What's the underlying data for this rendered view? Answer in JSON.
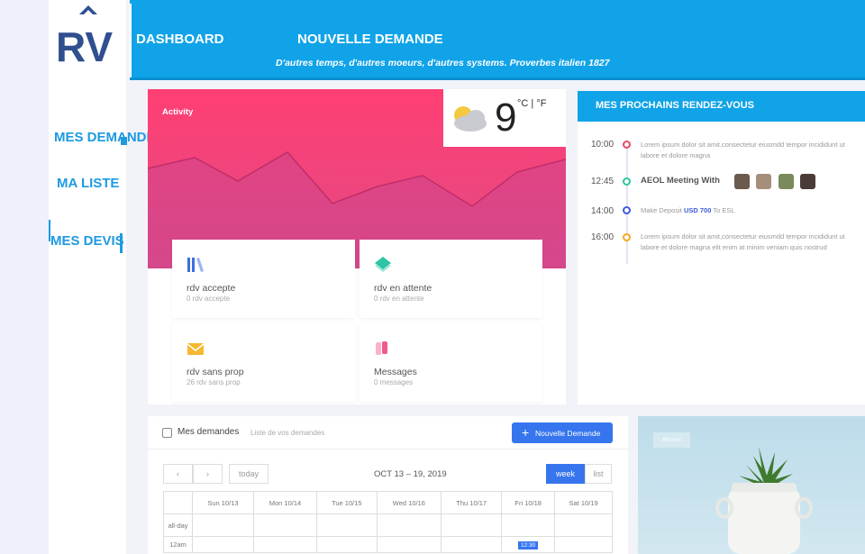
{
  "brand": {
    "logo_text": "RV"
  },
  "sidebar": {
    "items": [
      {
        "label": "MES DEMANDES"
      },
      {
        "label": "MA LISTE"
      },
      {
        "label": "MES DEVIS"
      }
    ]
  },
  "header": {
    "links": [
      {
        "label": "DASHBOARD"
      },
      {
        "label": "NOUVELLE DEMANDE"
      }
    ],
    "proverb": "D'autres temps, d'autres moeurs, d'autres systems. Proverbes italien 1827"
  },
  "activity": {
    "title": "Activity",
    "weather": {
      "temperature": "9",
      "units": "°C | °F",
      "icon": "partly-cloudy-icon"
    },
    "stats": [
      {
        "title": "rdv accepte",
        "subtitle": "0 rdv accepte",
        "icon": "books-icon",
        "color": "#3b6fe0"
      },
      {
        "title": "rdv en attente",
        "subtitle": "0 rdv en attente",
        "icon": "layers-icon",
        "color": "#2ec4a6"
      },
      {
        "title": "rdv sans prop",
        "subtitle": "26 rdv sans prop",
        "icon": "envelope-icon",
        "color": "#f5b82e"
      },
      {
        "title": "Messages",
        "subtitle": "0 messages",
        "icon": "message-icon",
        "color": "#f05c8c"
      }
    ]
  },
  "rendezvous": {
    "title": "MES PROCHAINS RENDEZ-VOUS",
    "events": [
      {
        "time": "10:00",
        "text": "Lorem ipsum dolor sit amit,consectetur eiusmdd tempor incididunt ut labore et dolore magna",
        "color": "#e84a6d"
      },
      {
        "time": "12:45",
        "text": "AEOL Meeting With",
        "color": "#2ec4a6"
      },
      {
        "time": "14:00",
        "text_before": "Make Deposit",
        "amount": "USD 700",
        "text_after": "To ESL",
        "color": "#3b5bdb"
      },
      {
        "time": "16:00",
        "text": "Lorem ipsum dolor sit amit,consectetur eiusmdd tempor incididunt ut labore et dolore magna elit enim at minim veniam quis nostrud",
        "color": "#f5a623"
      }
    ]
  },
  "demandes": {
    "title": "Mes demandes",
    "subtitle": "Liste de vos demandes",
    "new_button": "Nouvelle Demande",
    "calendar": {
      "prev": "‹",
      "next": "›",
      "today": "today",
      "range": "OCT 13 – 19, 2019",
      "view_week": "week",
      "view_list": "list",
      "days": [
        "Sun 10/13",
        "Mon 10/14",
        "Tue 10/15",
        "Wed 10/16",
        "Thu 10/17",
        "Fri 10/18",
        "Sat 10/19"
      ],
      "allday": "all-day",
      "row_label": "12am",
      "event_label": "12:30"
    }
  },
  "recent": {
    "label": "Recent"
  }
}
